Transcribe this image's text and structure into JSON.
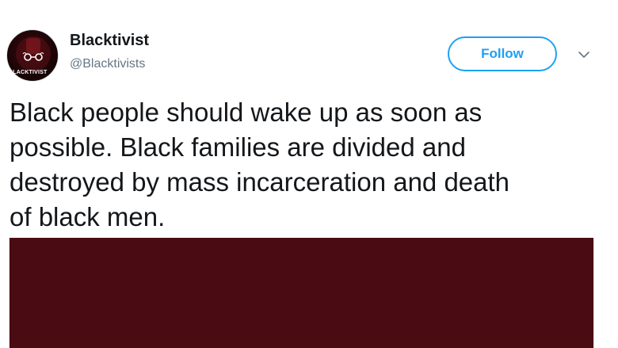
{
  "account": {
    "display_name": "Blacktivist",
    "handle": "@Blacktivists",
    "avatar_text": "BLACKTIVIST",
    "avatar_icon": "fist-logo-icon"
  },
  "actions": {
    "follow_label": "Follow",
    "menu_icon": "chevron-down-icon"
  },
  "tweet": {
    "text": "Black people should wake up as soon as\npossible. Black families are divided and\ndestroyed by mass incarceration and death\nof black men."
  },
  "media": {
    "background_color": "#4a0c12"
  },
  "colors": {
    "accent": "#1da1f2",
    "text_primary": "#14171a",
    "text_secondary": "#657786"
  }
}
